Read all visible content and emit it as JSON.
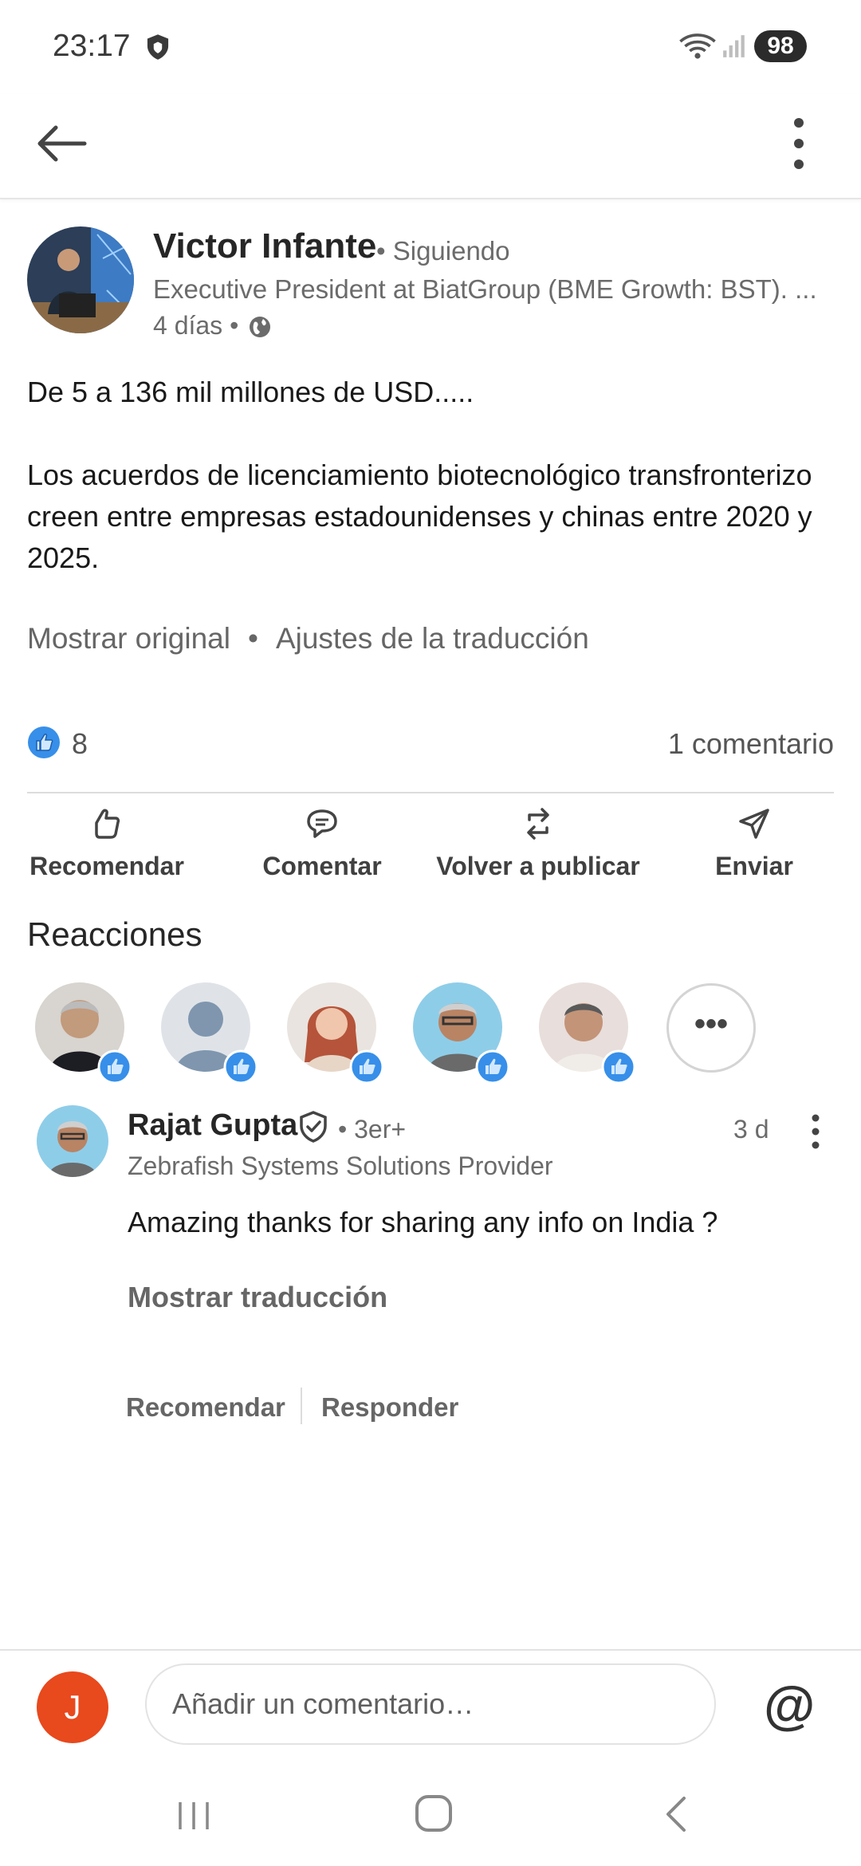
{
  "status_bar": {
    "time": "23:17",
    "battery": "98",
    "icons": [
      "shield-icon",
      "wifi-icon",
      "signal-icon"
    ]
  },
  "app_bar": {
    "back_icon": "arrow-left-icon",
    "menu_icon": "more-vertical-icon"
  },
  "post": {
    "author": {
      "name": "Victor Infante",
      "follow_status": "• Siguiendo",
      "headline": "Executive President at BiatGroup (BME Growth: BST). ...",
      "age": "4 días •"
    },
    "body": [
      "De 5 a 136 mil millones de USD.....",
      "Los acuerdos de licenciamiento biotecnológico transfronterizo creen entre empresas estadounidenses y chinas entre 2020 y 2025."
    ],
    "translation": {
      "show_original": "Mostrar original",
      "separator": "•",
      "settings": "Ajustes de la traducción"
    },
    "likes_count": "8",
    "comments_count": "1 comentario",
    "actions": {
      "like": "Recomendar",
      "comment": "Comentar",
      "repost": "Volver a publicar",
      "send": "Enviar"
    }
  },
  "reactions": {
    "title": "Reacciones",
    "more_label": "•••"
  },
  "comment": {
    "author": "Rajat Gupta",
    "degree": "• 3er+",
    "age": "3 d",
    "headline": "Zebrafish Systems Solutions Provider",
    "text": "Amazing thanks for sharing any info on India ?",
    "show_translation": "Mostrar traducción",
    "like": "Recomendar",
    "reply": "Responder"
  },
  "composer": {
    "user_initial": "J",
    "placeholder": "Añadir un comentario…",
    "mention": "@"
  },
  "colors": {
    "like_blue": "#378fe9",
    "avatar_orange": "#e8491d"
  }
}
